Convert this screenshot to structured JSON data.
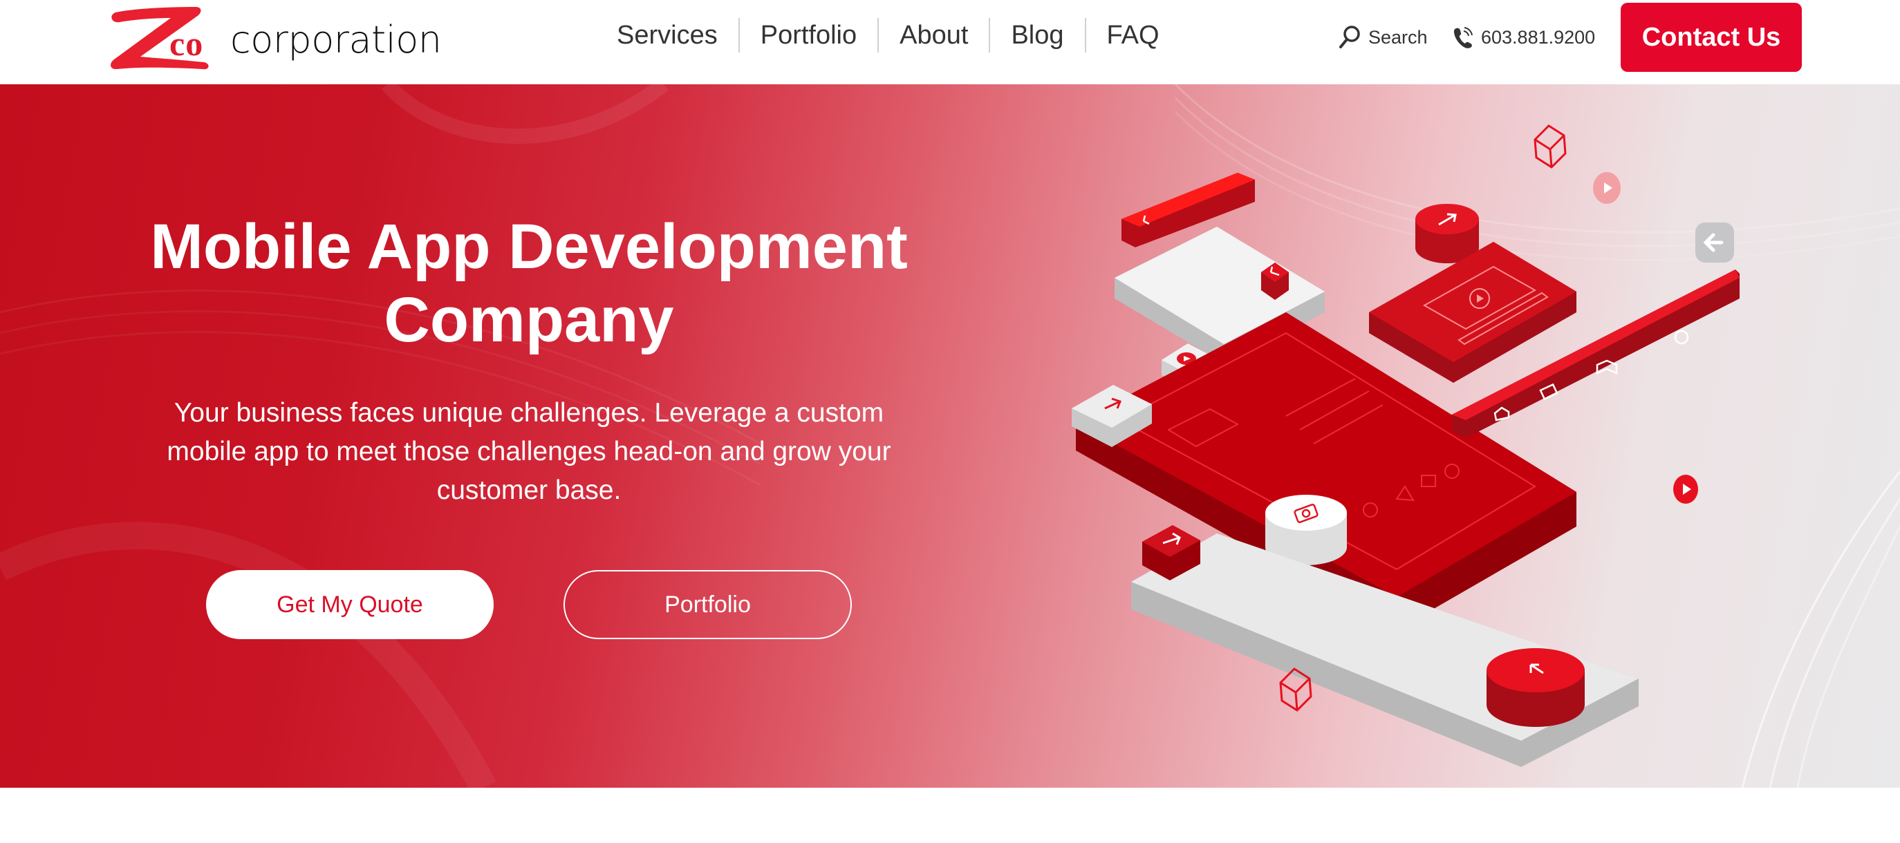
{
  "header": {
    "logo": {
      "mark": "Z",
      "co": "co",
      "name": "corporation",
      "alt": "Zco corporation"
    },
    "nav": [
      {
        "label": "Services"
      },
      {
        "label": "Portfolio"
      },
      {
        "label": "About"
      },
      {
        "label": "Blog"
      },
      {
        "label": "FAQ"
      }
    ],
    "search": {
      "icon": "search-icon",
      "label": "Search"
    },
    "phone": {
      "icon": "phone-icon",
      "label": "603.881.9200"
    },
    "contact_button": "Contact Us"
  },
  "hero": {
    "title_line1": "Mobile App Development",
    "title_line2": "Company",
    "description": "Your business faces unique challenges. Leverage a custom mobile app to meet those challenges head-on and grow your customer base.",
    "primary_button": "Get My Quote",
    "secondary_button": "Portfolio",
    "illustration": {
      "description": "isometric mobile app UI blocks",
      "icons": [
        "arrow-icon",
        "play-icon",
        "video-player-icon",
        "home-icon",
        "calendar-icon",
        "book-icon",
        "gear-icon",
        "camera-icon",
        "shapes-icon",
        "cube-outline-icon",
        "back-arrow-icon"
      ]
    }
  },
  "colors": {
    "brand_red": "#e4062b",
    "hero_red": "#c20e1d",
    "nav_text": "#333333",
    "hero_fade": "#e9e9ea"
  }
}
